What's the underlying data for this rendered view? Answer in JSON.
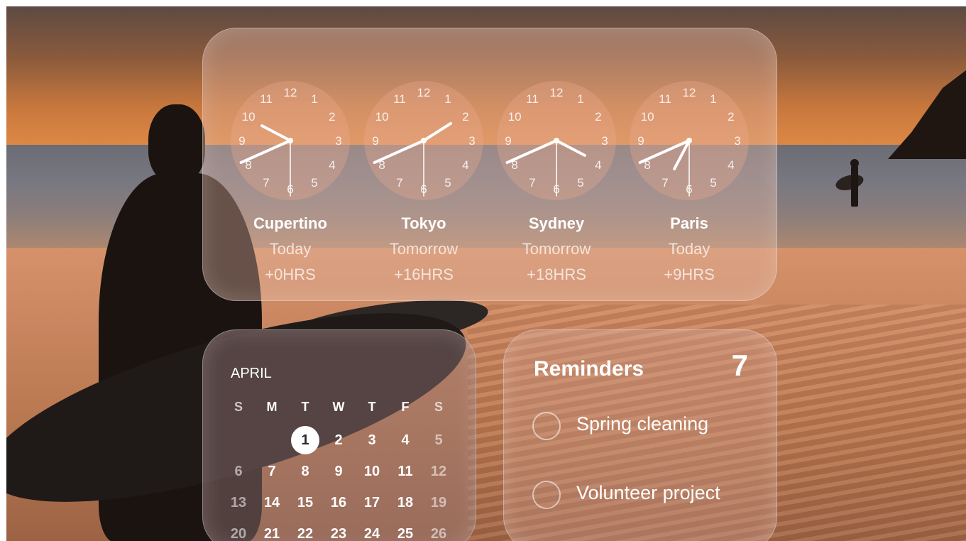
{
  "clocks": [
    {
      "city": "Cupertino",
      "day": "Today",
      "offset": "+0HRS",
      "hour": 9.92,
      "minute": 41,
      "second": 30
    },
    {
      "city": "Tokyo",
      "day": "Tomorrow",
      "offset": "+16HRS",
      "hour": 1.92,
      "minute": 41,
      "second": 30
    },
    {
      "city": "Sydney",
      "day": "Tomorrow",
      "offset": "+18HRS",
      "hour": 3.92,
      "minute": 41,
      "second": 30
    },
    {
      "city": "Paris",
      "day": "Today",
      "offset": "+9HRS",
      "hour": 6.92,
      "minute": 41,
      "second": 30
    }
  ],
  "clock_numerals": [
    "12",
    "1",
    "2",
    "3",
    "4",
    "5",
    "6",
    "7",
    "8",
    "9",
    "10",
    "11"
  ],
  "calendar": {
    "month": "APRIL",
    "weekdays": [
      "S",
      "M",
      "T",
      "W",
      "T",
      "F",
      "S"
    ],
    "weeks": [
      [
        "",
        "",
        "1",
        "2",
        "3",
        "4",
        "5"
      ],
      [
        "6",
        "7",
        "8",
        "9",
        "10",
        "11",
        "12"
      ],
      [
        "13",
        "14",
        "15",
        "16",
        "17",
        "18",
        "19"
      ],
      [
        "20",
        "21",
        "22",
        "23",
        "24",
        "25",
        "26"
      ]
    ],
    "today": "1"
  },
  "reminders": {
    "title": "Reminders",
    "count": "7",
    "items": [
      "Spring cleaning",
      "Volunteer project"
    ]
  },
  "colors": {
    "clock_hand": "#ffffff",
    "today_circle": "#ffffff"
  }
}
